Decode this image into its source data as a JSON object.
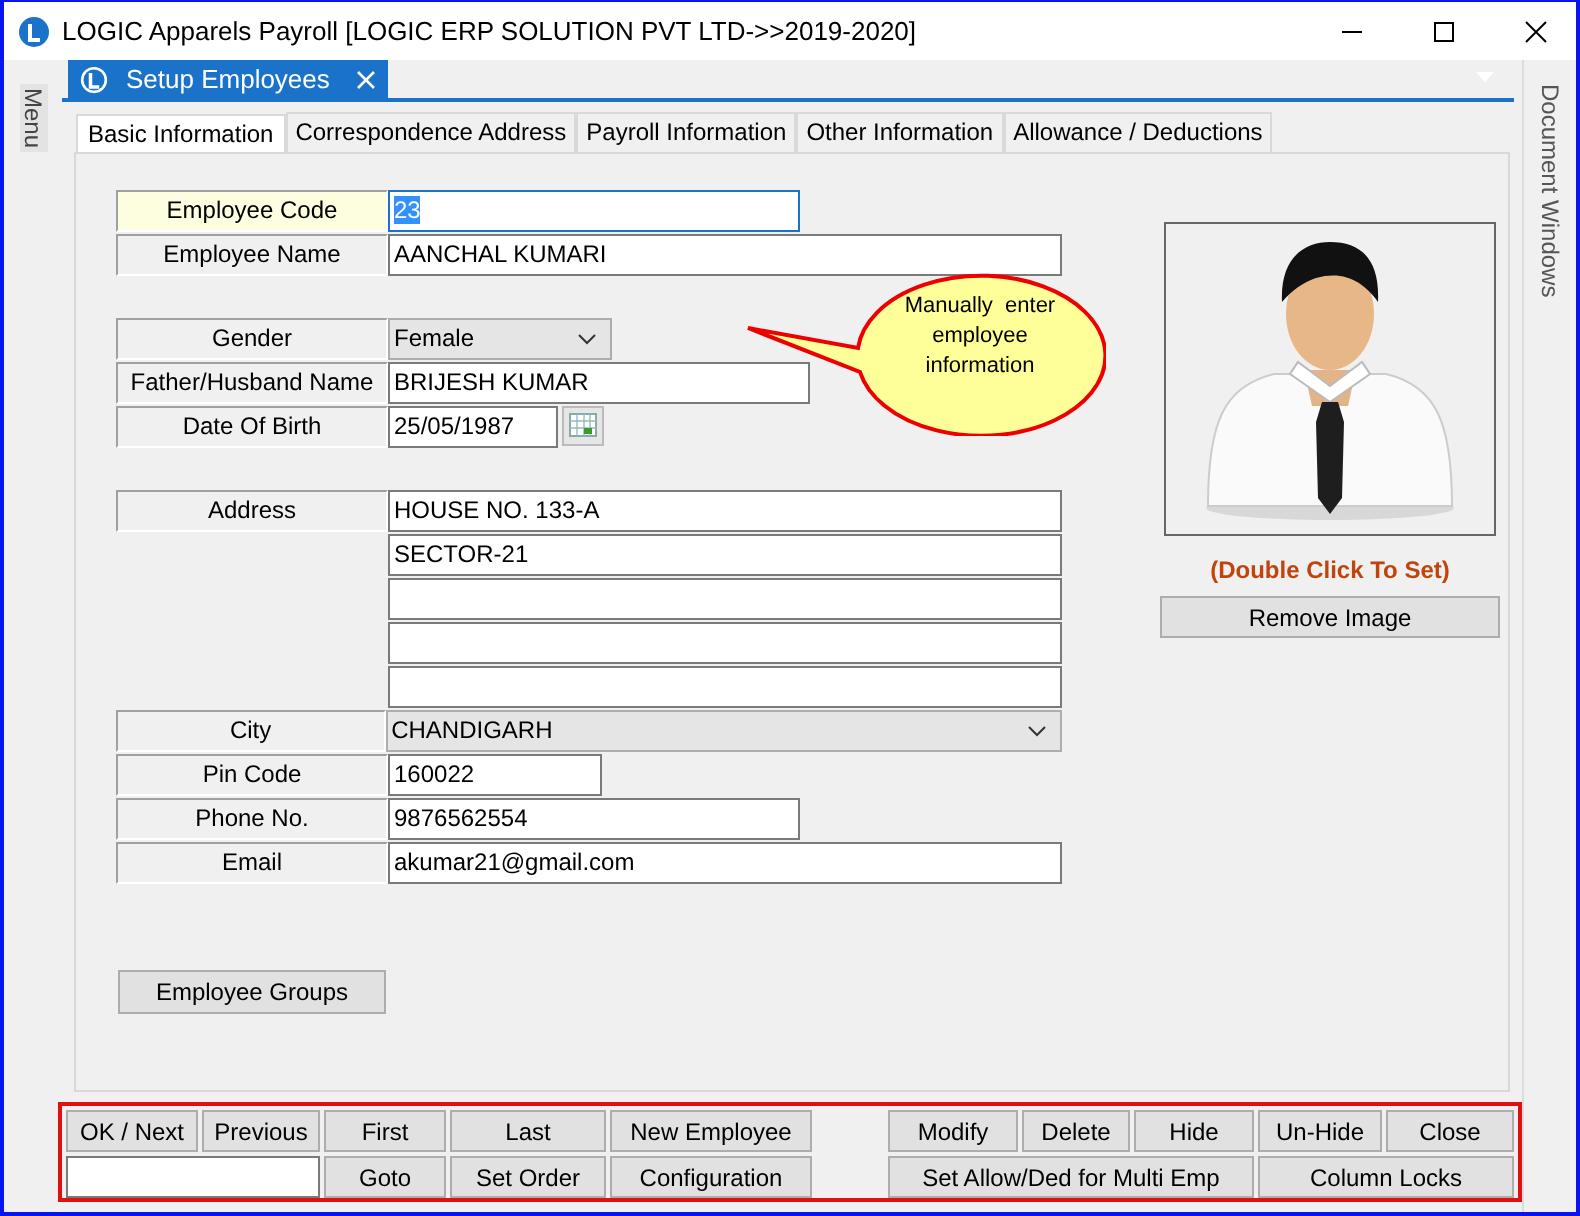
{
  "window": {
    "title": "LOGIC Apparels Payroll  [LOGIC ERP SOLUTION PVT LTD->>2019-2020]"
  },
  "side_panels": {
    "left": "Menu",
    "right": "Document Windows"
  },
  "document_tab": {
    "title": "Setup Employees"
  },
  "tabs": [
    {
      "label": "Basic Information",
      "selected": true
    },
    {
      "label": "Correspondence Address",
      "selected": false
    },
    {
      "label": "Payroll Information",
      "selected": false
    },
    {
      "label": "Other Information",
      "selected": false
    },
    {
      "label": "Allowance / Deductions",
      "selected": false
    }
  ],
  "form": {
    "groups": [
      [
        {
          "label": "Employee Code",
          "kind": "text",
          "value": "23",
          "focused": true
        },
        {
          "label": "Employee Name",
          "kind": "text",
          "value": "AANCHAL KUMARI",
          "focused": false
        }
      ],
      [
        {
          "label": "Gender",
          "kind": "dropdown",
          "value": "Female",
          "focused": false
        },
        {
          "label": "Father/Husband Name",
          "kind": "text",
          "value": "BRIJESH KUMAR",
          "focused": false
        },
        {
          "label": "Date Of Birth",
          "kind": "date",
          "value": "25/05/1987",
          "focused": false
        }
      ],
      [
        {
          "label": "Address",
          "kind": "multiline",
          "lines": [
            "HOUSE NO. 133-A",
            "SECTOR-21"
          ],
          "focused": false
        },
        {
          "label": "City",
          "kind": "dropdown",
          "value": "CHANDIGARH",
          "focused": false
        },
        {
          "label": "Pin Code",
          "kind": "text",
          "value": "160022",
          "focused": false
        },
        {
          "label": "Phone No.",
          "kind": "text",
          "value": "9876562554",
          "focused": false
        },
        {
          "label": "Email",
          "kind": "text",
          "value": "akumar21@gmail.com",
          "focused": false
        }
      ]
    ]
  },
  "employee_groups_button": "Employee Groups",
  "callout": {
    "lines": [
      "Manually  enter",
      "employee",
      "information"
    ]
  },
  "photo": {
    "kind": "picture",
    "caption": "(Double Click To Set)",
    "button": "Remove Image"
  },
  "toolbar": {
    "row1": [
      "OK / Next",
      "Previous",
      "First",
      "Last",
      "New Employee",
      "Modify",
      "Delete",
      "Hide",
      "Un-Hide",
      "Close"
    ],
    "row2": [
      {
        "kind": "field"
      },
      {
        "kind": "button",
        "label": "Goto"
      },
      {
        "kind": "button",
        "label": "Set Order"
      },
      {
        "kind": "button",
        "label": "Configuration"
      },
      {
        "kind": "button",
        "label": "Set Allow/Ded for Multi Emp"
      },
      {
        "kind": "button",
        "label": "Column Locks"
      }
    ]
  }
}
